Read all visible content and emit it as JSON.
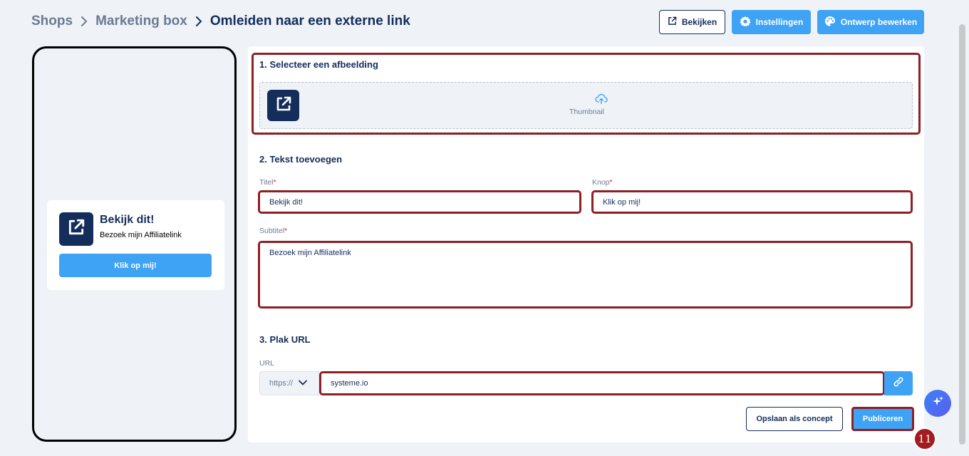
{
  "breadcrumb": {
    "item1": "Shops",
    "item2": "Marketing box",
    "current": "Omleiden naar een externe link"
  },
  "header_buttons": {
    "view": "Bekijken",
    "settings": "Instellingen",
    "edit_design": "Ontwerp bewerken"
  },
  "preview": {
    "title": "Bekijk dit!",
    "subtitle": "Bezoek mijn Affiliatelink",
    "button": "Klik op mij!"
  },
  "form": {
    "section1": {
      "title": "1. Selecteer een afbeelding",
      "thumbnail_label": "Thumbnail"
    },
    "section2": {
      "title": "2. Tekst toevoegen",
      "title_label": "Titel",
      "title_value": "Bekijk dit!",
      "button_label": "Knop",
      "button_value": "Klik op mij!",
      "subtitle_label": "Subtitel",
      "subtitle_value": "Bezoek mijn Affiliatelink",
      "required_mark": "*"
    },
    "section3": {
      "title": "3. Plak URL",
      "url_label": "URL",
      "scheme": "https://",
      "url_value": "systeme.io"
    }
  },
  "footer_buttons": {
    "save_draft": "Opslaan als concept",
    "publish": "Publiceren"
  },
  "step_badge": "11",
  "colors": {
    "navy": "#142d5b",
    "blue": "#3ea2f5",
    "highlight": "#8e1f25",
    "badge": "#a11b1f"
  },
  "icons": [
    "chevron-right-icon",
    "external-link-icon",
    "gear-icon",
    "palette-icon",
    "upload-cloud-icon",
    "chevron-down-icon",
    "link-icon",
    "sparkle-icon"
  ]
}
